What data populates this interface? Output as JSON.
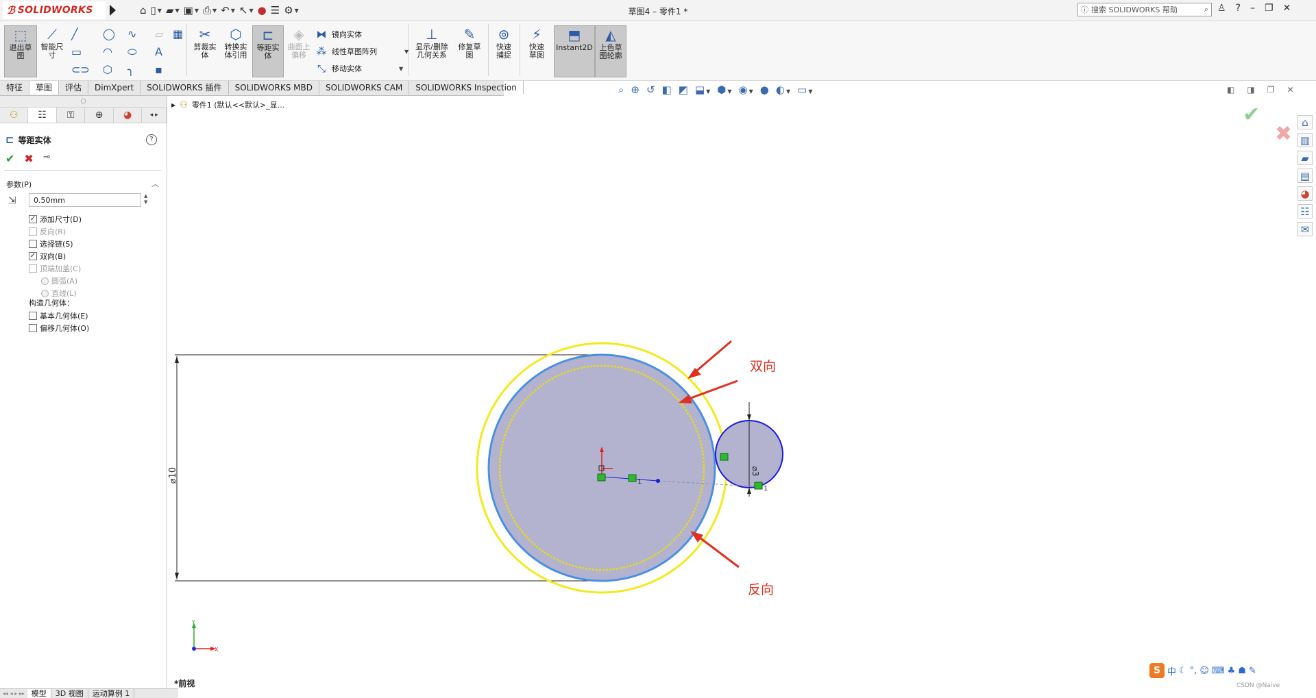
{
  "app": {
    "brand": "SOLIDWORKS",
    "doc_title": "草图4 – 零件1 *"
  },
  "search": {
    "placeholder": "搜索 SOLIDWORKS 帮助"
  },
  "ribbon": {
    "exit_sketch": "退出草图",
    "smart_dim": "智能尺寸",
    "trim": "剪裁实体",
    "convert": "转换实体引用",
    "offset": "等距实体",
    "surface_offset": "曲面上偏移",
    "mirror": "镜向实体",
    "linear_pattern": "线性草图阵列",
    "move": "移动实体",
    "show_relations": "显示/删除几何关系",
    "repair": "修复草图",
    "quick_snaps": "快速捕捉",
    "rapid_sketch": "快速草图",
    "instant2d": "Instant2D",
    "shaded_contours": "上色草图轮廓"
  },
  "tabs": [
    "特征",
    "草图",
    "评估",
    "DimXpert",
    "SOLIDWORKS 插件",
    "SOLIDWORKS MBD",
    "SOLIDWORKS CAM",
    "SOLIDWORKS Inspection"
  ],
  "active_tab": 1,
  "panel": {
    "title": "等距实体",
    "group": "参数(P)",
    "distance": "0.50mm",
    "checkboxes": [
      {
        "label": "添加尺寸(D)",
        "checked": true,
        "enabled": true
      },
      {
        "label": "反向(R)",
        "checked": false,
        "enabled": false
      },
      {
        "label": "选择链(S)",
        "checked": false,
        "enabled": true
      },
      {
        "label": "双向(B)",
        "checked": true,
        "enabled": true
      },
      {
        "label": "顶端加盖(C)",
        "checked": false,
        "enabled": false
      }
    ],
    "cap_options": [
      "圆弧(A)",
      "直线(L)"
    ],
    "construction_label": "构造几何体：",
    "construction": [
      {
        "label": "基本几何体(E)",
        "checked": false
      },
      {
        "label": "偏移几何体(O)",
        "checked": false
      }
    ]
  },
  "tree": {
    "item": "零件1  (默认<<默认>_显..."
  },
  "canvas": {
    "dim_large": "⌀10",
    "dim_small": "⌀3",
    "annotation_top": "双向",
    "annotation_bottom": "反向",
    "view_name": "*前视",
    "relation_label": "1",
    "axis_x": "X",
    "axis_y": "Y"
  },
  "colors": {
    "offset_outer": "#f2ea1c",
    "selected_circle": "#4a90e2",
    "fill": "#b3b3d0",
    "annotation": "#e03020",
    "small_circle_edge": "#1a1ae0"
  },
  "bottom_tabs": [
    "模型",
    "3D 视图",
    "运动算例 1"
  ],
  "active_bottom_tab": 0,
  "ime": {
    "logo": "S",
    "lang": "中"
  },
  "watermark": "CSDN @Naive"
}
